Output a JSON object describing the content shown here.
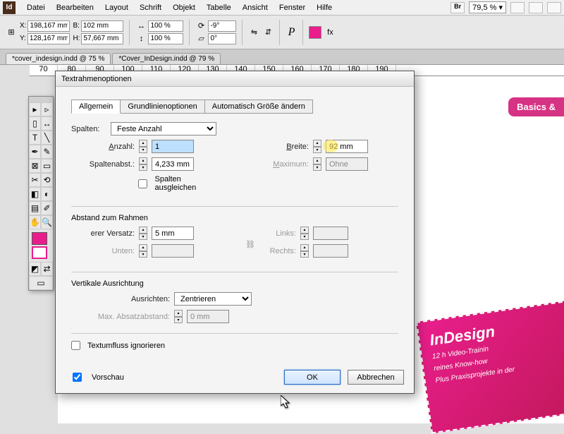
{
  "menu": {
    "items": [
      "Datei",
      "Bearbeiten",
      "Layout",
      "Schrift",
      "Objekt",
      "Tabelle",
      "Ansicht",
      "Fenster",
      "Hilfe"
    ],
    "br": "Br",
    "zoom": "79,5 %"
  },
  "control": {
    "x": "198,167 mm",
    "y": "128,167 mm",
    "w": "102 mm",
    "h": "57,667 mm",
    "scalex": "100 %",
    "scaley": "100 %",
    "rotate": "-9°",
    "shear": "0°"
  },
  "tabs": {
    "a": "*cover_indesign.indd @ 75 %",
    "b": "*Cover_InDesign.indd @ 79 %"
  },
  "ruler": [
    "70",
    "80",
    "90",
    "100",
    "110",
    "120",
    "130",
    "140",
    "150",
    "160",
    "170",
    "180",
    "190"
  ],
  "dialog": {
    "title": "Textrahmenoptionen",
    "tabs": {
      "a": "Allgemein",
      "b": "Grundlinienoptionen",
      "c": "Automatisch Größe ändern"
    },
    "spalten": {
      "label": "Spalten:",
      "mode": "Feste Anzahl",
      "anzahl_label": "Anzahl:",
      "anzahl": "1",
      "abst_label": "Spaltenabst.:",
      "abst": "4,233 mm",
      "breite_label": "Breite:",
      "breite": "92 mm",
      "max_label": "Maximum:",
      "max": "Ohne",
      "ausgleich": "Spalten ausgleichen"
    },
    "abstand": {
      "head": "Abstand zum Rahmen",
      "versatz_label": "erer Versatz:",
      "versatz": "5 mm",
      "unten_label": "Unten:",
      "links_label": "Links:",
      "rechts_label": "Rechts:"
    },
    "vert": {
      "head": "Vertikale Ausrichtung",
      "ausrichten_label": "Ausrichten:",
      "ausrichten": "Zentrieren",
      "maxabs_label": "Max. Absatzabstand:",
      "maxabs": "0 mm"
    },
    "ignore": "Textumfluss ignorieren",
    "preview": "Vorschau",
    "ok": "OK",
    "cancel": "Abbrechen"
  },
  "canvas": {
    "basics": "Basics &",
    "pink_title": "InDesign",
    "pink_sub1": "12 h Video-Trainin",
    "pink_sub2": "reines Know-how",
    "pink_sub3": "Plus Praxisprojekte in der"
  }
}
